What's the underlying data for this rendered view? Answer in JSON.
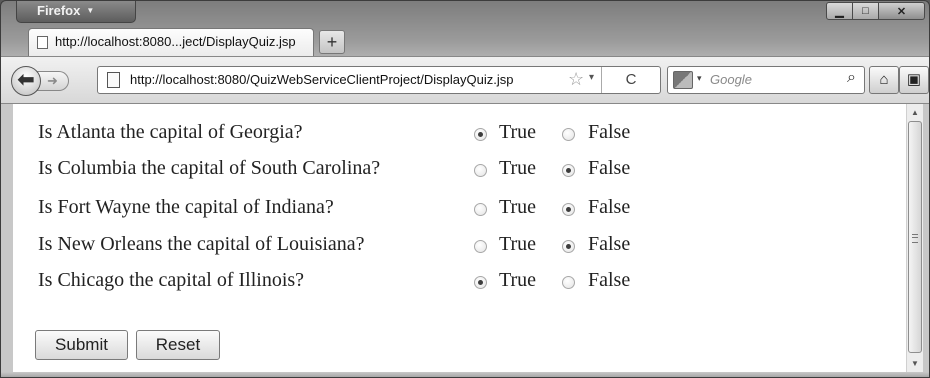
{
  "browser": {
    "menu_button": "Firefox",
    "tab_title": "http://localhost:8080...ject/DisplayQuiz.jsp",
    "new_tab_label": "+",
    "url": "http://localhost:8080/QuizWebServiceClientProject/DisplayQuiz.jsp",
    "search_placeholder": "Google",
    "icons": [
      "back-icon",
      "forward-icon",
      "page-icon",
      "star-icon",
      "reload-icon",
      "search-engine-icon",
      "search-icon",
      "home-icon",
      "addon-icon",
      "minimize-icon",
      "maximize-icon",
      "close-icon"
    ]
  },
  "quiz": {
    "questions": [
      {
        "text": "Is Atlanta the capital of Georgia?",
        "answer": "True"
      },
      {
        "text": "Is Columbia the capital of South Carolina?",
        "answer": "False"
      },
      {
        "text": "Is Fort Wayne the capital of Indiana?",
        "answer": "False"
      },
      {
        "text": "Is New Orleans the capital of Louisiana?",
        "answer": "False"
      },
      {
        "text": "Is Chicago the capital of Illinois?",
        "answer": "True"
      }
    ],
    "true_label": "True",
    "false_label": "False",
    "submit_label": "Submit",
    "reset_label": "Reset"
  }
}
